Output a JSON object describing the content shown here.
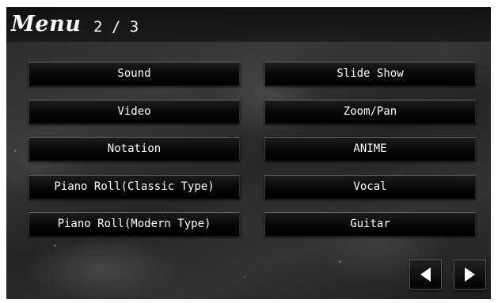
{
  "header": {
    "title": "Menu",
    "page_indicator": "2 / 3"
  },
  "menu": {
    "left_column": [
      {
        "label": "Sound"
      },
      {
        "label": "Video"
      },
      {
        "label": "Notation"
      },
      {
        "label": "Piano Roll(Classic Type)"
      },
      {
        "label": "Piano Roll(Modern Type)"
      }
    ],
    "right_column": [
      {
        "label": "Slide Show"
      },
      {
        "label": "Zoom/Pan"
      },
      {
        "label": "ANIME"
      },
      {
        "label": "Vocal"
      },
      {
        "label": "Guitar"
      }
    ]
  },
  "navigation": {
    "prev_icon": "triangle-left-icon",
    "next_icon": "triangle-right-icon"
  },
  "colors": {
    "background": "#2a2a2a",
    "button": "#000000",
    "text": "#ffffff"
  }
}
